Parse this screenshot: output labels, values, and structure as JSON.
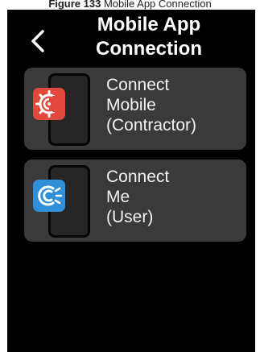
{
  "caption": {
    "label": "Figure 133",
    "text": "Mobile App Connection"
  },
  "header": {
    "back_icon": "chevron-left-icon",
    "title": "Mobile App\nConnection"
  },
  "options": [
    {
      "label": "Connect\nMobile\n(Contractor)",
      "icon": "connect-mobile-app-icon",
      "icon_color": "#e2483c"
    },
    {
      "label": "Connect\nMe\n(User)",
      "icon": "connect-me-app-icon",
      "icon_color": "#2f8fd8"
    }
  ],
  "colors": {
    "screen_background": "#000000",
    "card_background": "#3a3a3a",
    "text": "#ffffff"
  }
}
